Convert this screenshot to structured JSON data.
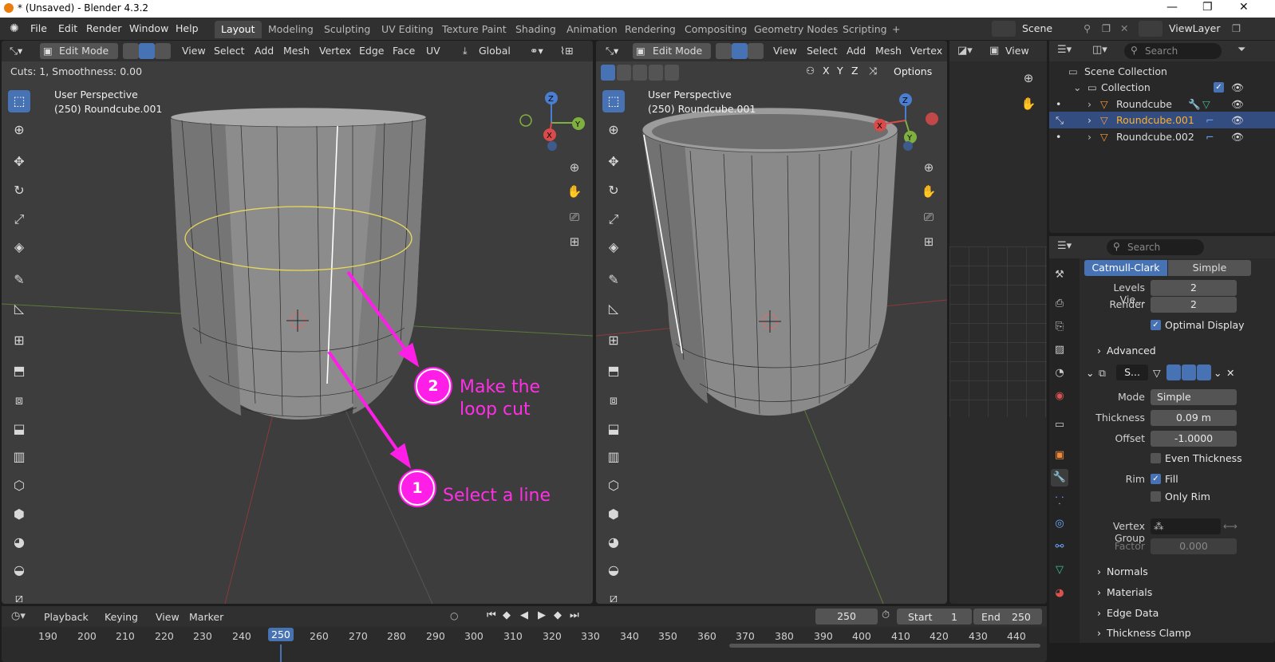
{
  "window": {
    "title": "* (Unsaved) - Blender 4.3.2",
    "controls": [
      "—",
      "❐",
      "✕"
    ]
  },
  "menubar": {
    "items": [
      "File",
      "Edit",
      "Render",
      "Window",
      "Help"
    ],
    "workspaces": [
      "Layout",
      "Modeling",
      "Sculpting",
      "UV Editing",
      "Texture Paint",
      "Shading",
      "Animation",
      "Rendering",
      "Compositing",
      "Geometry Nodes",
      "Scripting",
      "+"
    ],
    "active_workspace": "Layout",
    "scene": "Scene",
    "view_layer": "ViewLayer"
  },
  "left_viewport": {
    "mode": "Edit Mode",
    "menus": [
      "View",
      "Select",
      "Add",
      "Mesh",
      "Vertex",
      "Edge",
      "Face",
      "UV"
    ],
    "orientation": "Global",
    "operator_hint": "Cuts: 1, Smoothness: 0.00",
    "perspective": "User Perspective",
    "object": "(250) Roundcube.001"
  },
  "right_viewport": {
    "mode": "Edit Mode",
    "menus": [
      "View",
      "Select",
      "Add",
      "Mesh",
      "Vertex"
    ],
    "axes": [
      "X",
      "Y",
      "Z"
    ],
    "options": "Options",
    "perspective": "User Perspective",
    "object": "(250) Roundcube.001"
  },
  "image_panel": {
    "view_label": "View"
  },
  "outliner": {
    "search_placeholder": "Search",
    "scene_collection": "Scene Collection",
    "collection": "Collection",
    "objects": [
      {
        "name": "Roundcube",
        "selected": false
      },
      {
        "name": "Roundcube.001",
        "selected": true
      },
      {
        "name": "Roundcube.002",
        "selected": false
      }
    ]
  },
  "properties": {
    "search_placeholder": "Search",
    "subdiv_tabs": [
      "Catmull-Clark",
      "Simple"
    ],
    "levels_viewport_label": "Levels Vie...",
    "levels_viewport": "2",
    "render_label": "Render",
    "render": "2",
    "optimal_display": "Optimal Display",
    "advanced": "Advanced",
    "modifier_name": "S...",
    "mode_label": "Mode",
    "mode_value": "Simple",
    "thickness_label": "Thickness",
    "thickness": "0.09 m",
    "offset_label": "Offset",
    "offset": "-1.0000",
    "even_thickness": "Even Thickness",
    "rim_label": "Rim",
    "fill": "Fill",
    "only_rim": "Only Rim",
    "vertex_group_label": "Vertex Group",
    "factor_label": "Factor",
    "factor": "0.000",
    "sections": [
      "Normals",
      "Materials",
      "Edge Data",
      "Thickness Clamp"
    ]
  },
  "timeline": {
    "menus": [
      "Playback",
      "Keying",
      "View",
      "Marker"
    ],
    "current_frame": "250",
    "start_label": "Start",
    "start": "1",
    "end_label": "End",
    "end": "250",
    "ruler": [
      "190",
      "200",
      "210",
      "220",
      "230",
      "240",
      "250",
      "260",
      "270",
      "280",
      "290",
      "300",
      "310",
      "320",
      "330",
      "340",
      "350",
      "360",
      "370",
      "380",
      "390",
      "400",
      "410",
      "420",
      "430",
      "440"
    ]
  },
  "annotations": [
    {
      "number": "2",
      "text_line1": "Make the",
      "text_line2": "loop cut"
    },
    {
      "number": "1",
      "text": "Select a line"
    }
  ],
  "colors": {
    "accent": "#4772b3",
    "annotation": "#ff1ee8",
    "selected_object": "#ffaf29",
    "selection_loop": "#e8d95a"
  }
}
